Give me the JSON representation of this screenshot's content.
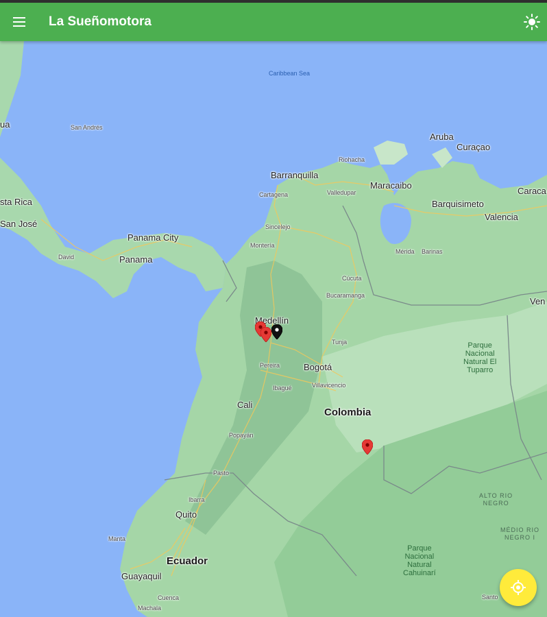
{
  "app": {
    "title": "La Sueñomotora",
    "colors": {
      "appbar": "#4caf50",
      "fab": "#ffeb3b",
      "water": "#8ab4f8",
      "land": "#a5d6a7"
    }
  },
  "icons": {
    "menu": "menu-icon",
    "theme": "sun-icon",
    "location": "my-location-icon",
    "marker": "map-pin-icon"
  },
  "map": {
    "sea": "Caribbean Sea",
    "countries": [
      "Colombia",
      "Panama",
      "Ecuador",
      "Ven"
    ],
    "cities": {
      "barranquilla": "Barranquilla",
      "maracaibo": "Maracaibo",
      "aruba": "Aruba",
      "curacao": "Curaçao",
      "caracas": "Caraca",
      "barquisimeto": "Barquisimeto",
      "valencia": "Valencia",
      "panama_city": "Panama City",
      "medellin": "Medellín",
      "bogota": "Bogotá",
      "cali": "Cali",
      "quito": "Quito",
      "guayaquil": "Guayaquil",
      "costa_rica": "sta Rica",
      "san_jose": "San José",
      "ua": "ua"
    },
    "towns": {
      "san_andres": "San Andrés",
      "riohacha": "Riohacha",
      "cartagena": "Cartagena",
      "valledupar": "Valledupar",
      "sincelejo": "Sincelejo",
      "monteria": "Montería",
      "cucuta": "Cúcuta",
      "bucaramanga": "Bucaramanga",
      "merida": "Mérida",
      "barinas": "Barinas",
      "david": "David",
      "tunja": "Tunja",
      "pereira": "Pereira",
      "ibague": "Ibagué",
      "villavicencio": "Villavicencio",
      "popayan": "Popayán",
      "pasto": "Pasto",
      "ibarra": "Ibarra",
      "manta": "Manta",
      "cuenca": "Cuenca",
      "machala": "Machala",
      "santo": "Santo"
    },
    "parks": {
      "tuparro": "Parque\nNacional\nNatural El\nTuparro",
      "cahuinari": "Parque\nNacional\nNatural\nCahuinarí"
    },
    "regions": {
      "alto_rio_negro": "ALTO RIO\nNEGRO",
      "medio_rio_negro": "MÉDIO RIO\nNEGRO I"
    },
    "markers": [
      {
        "color": "#e53935",
        "label": "red-marker-1"
      },
      {
        "color": "#e53935",
        "label": "red-marker-2"
      },
      {
        "color": "#111111",
        "label": "black-marker"
      },
      {
        "color": "#e53935",
        "label": "red-marker-3"
      }
    ]
  }
}
